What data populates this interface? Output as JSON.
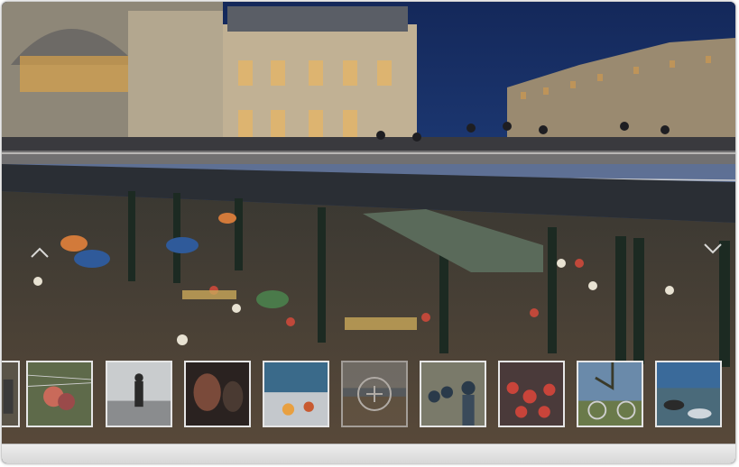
{
  "viewer": {
    "image_name": "refugees-budapest-keleti-station-night",
    "prev_icon": "chevron-up-icon",
    "next_icon": "chevron-down-icon",
    "add_icon": "plus-circle-icon"
  },
  "thumbnails": [
    {
      "subject": "partial-edge-photo"
    },
    {
      "subject": "family-behind-barbed-wire"
    },
    {
      "subject": "person-walking-in-rain"
    },
    {
      "subject": "faces-in-dark"
    },
    {
      "subject": "people-by-fire-at-night"
    },
    {
      "subject": "station-square",
      "selected": true
    },
    {
      "subject": "crowd-with-police"
    },
    {
      "subject": "crowd-in-red"
    },
    {
      "subject": "bicycle-under-tree"
    },
    {
      "subject": "sea-and-rocks"
    }
  ],
  "colors": {
    "sky": "#1d3d78",
    "building": "#b7a88e",
    "bridge": "#2a2f36",
    "plaza": "#4a4034",
    "thumb_border": "#e6e6e6",
    "bottom_bar": "#e0e0e0"
  }
}
